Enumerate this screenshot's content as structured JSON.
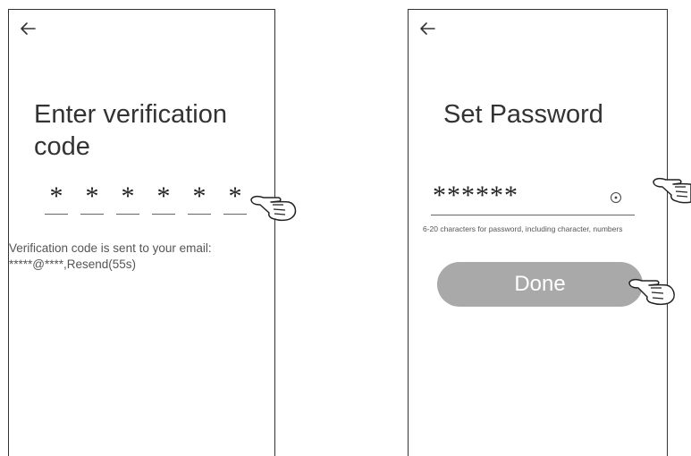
{
  "screen_1": {
    "back_icon": "arrow-left-icon",
    "title": "Enter verification code",
    "code_digits": [
      "*",
      "*",
      "*",
      "*",
      "*",
      "*"
    ],
    "info_line_1": "Verification code is sent to your email:",
    "info_line_2": "*****@****,Resend(55s)"
  },
  "screen_2": {
    "back_icon": "arrow-left-icon",
    "title": "Set Password",
    "password_value": "******",
    "eye_icon": "eye-icon",
    "hint": "6-20 characters for password, including character, numbers",
    "done_label": "Done"
  },
  "annotations": {
    "pointer_icon": "pointing-hand-icon"
  },
  "colors": {
    "done_button_bg": "#a9a9a9",
    "done_button_text": "#ffffff"
  }
}
